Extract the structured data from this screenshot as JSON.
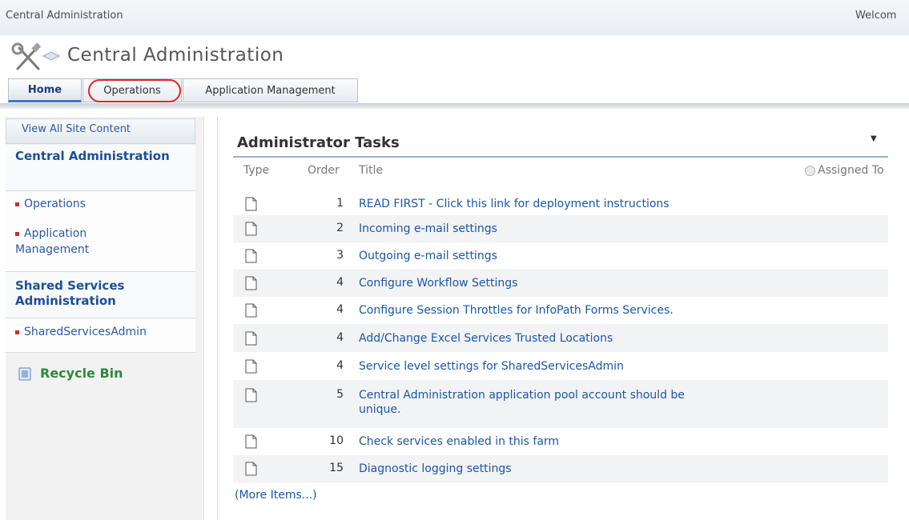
{
  "header": {
    "site_name": "Central Administration",
    "welcome": "Welcom",
    "title": "Central Administration"
  },
  "tabs": [
    {
      "label": "Home",
      "selected": true
    },
    {
      "label": "Operations",
      "highlighted": true
    },
    {
      "label": "Application Management"
    }
  ],
  "leftnav": {
    "view_all": "View All Site Content",
    "sections": [
      {
        "title": "Central Administration",
        "links": [
          "Operations",
          "Application Management"
        ]
      },
      {
        "title": "Shared Services Administration",
        "links": [
          "SharedServicesAdmin"
        ]
      }
    ],
    "recycle_bin": "Recycle Bin"
  },
  "tasks": {
    "title": "Administrator Tasks",
    "columns": {
      "type": "Type",
      "order": "Order",
      "title": "Title",
      "assigned": "Assigned To"
    },
    "rows": [
      {
        "order": "1",
        "title": "READ FIRST - Click this link for deployment instructions"
      },
      {
        "order": "2",
        "title": "Incoming e-mail settings"
      },
      {
        "order": "3",
        "title": "Outgoing e-mail settings"
      },
      {
        "order": "4",
        "title": "Configure Workflow Settings"
      },
      {
        "order": "4",
        "title": "Configure Session Throttles for InfoPath Forms Services."
      },
      {
        "order": "4",
        "title": "Add/Change Excel Services Trusted Locations"
      },
      {
        "order": "4",
        "title": "Service level settings for SharedServicesAdmin"
      },
      {
        "order": "5",
        "title": "Central Administration application pool account should be",
        "title2": "unique."
      },
      {
        "order": "10",
        "title": "Check services enabled in this farm"
      },
      {
        "order": "15",
        "title": "Diagnostic logging settings"
      }
    ],
    "more": "(More Items...)"
  },
  "colors": {
    "link": "#1b57a8",
    "nav_heading": "#1c4f96",
    "recycle": "#2d8a3a",
    "highlight_circle": "#e2252a"
  }
}
